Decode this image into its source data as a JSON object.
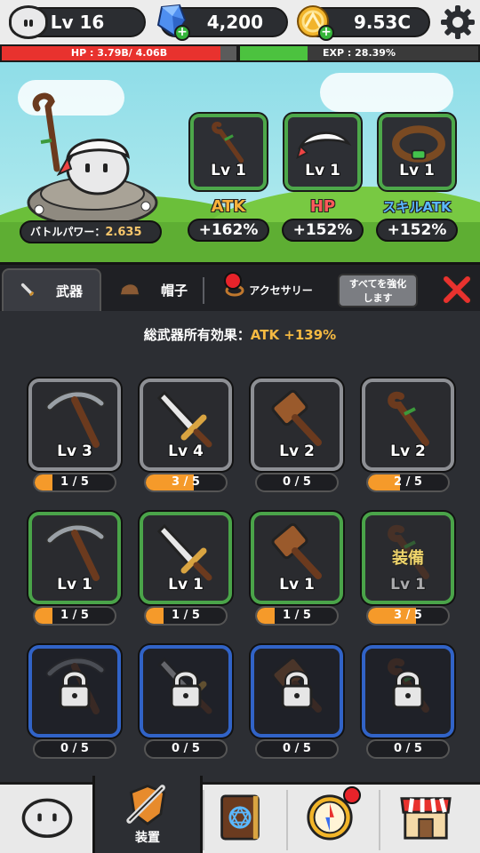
{
  "topbar": {
    "level": "Lv 16",
    "gems": "4,200",
    "coins": "9.53C"
  },
  "status": {
    "hp_text": "HP : 3.79B/ 4.06B",
    "hp_fraction": 0.933,
    "exp_text": "EXP : 28.39%",
    "exp_fraction": 0.2839
  },
  "character": {
    "power_label": "バトルパワー：",
    "power_value": "2.635"
  },
  "equipped": [
    {
      "slot": "weapon",
      "icon": "staff-icon",
      "level": "Lv 1",
      "stat_label": "ATK",
      "stat_color": "#f7b23b",
      "bonus": "+162%"
    },
    {
      "slot": "hat",
      "icon": "headband-icon",
      "level": "Lv 1",
      "stat_label": "HP",
      "stat_color": "#ff5a5a",
      "bonus": "+152%"
    },
    {
      "slot": "accessory",
      "icon": "bracelet-icon",
      "level": "Lv 1",
      "stat_label": "スキルATK",
      "stat_color": "#5ab8ff",
      "bonus": "+152%"
    }
  ],
  "tabs": [
    {
      "label": "武器",
      "icon": "sword-icon",
      "active": true
    },
    {
      "label": "帽子",
      "icon": "hat-icon",
      "active": false
    },
    {
      "label": "アクセサリー",
      "icon": "ring-icon",
      "active": false,
      "notify": true
    }
  ],
  "enhance_all": "すべてを強化\nします",
  "summary": {
    "label": "総武器所有効果：",
    "value": "ATK +139%"
  },
  "equipped_marker": "装備",
  "weapons": [
    {
      "icon": "pickaxe-icon",
      "rarity": "gray",
      "level": "Lv 3",
      "progress": "1 / 5",
      "fraction": 0.2
    },
    {
      "icon": "dagger-icon",
      "rarity": "gray",
      "level": "Lv 4",
      "progress": "3 / 5",
      "fraction": 0.6
    },
    {
      "icon": "hammer-icon",
      "rarity": "gray",
      "level": "Lv 2",
      "progress": "0 / 5",
      "fraction": 0
    },
    {
      "icon": "staff-icon",
      "rarity": "gray",
      "level": "Lv 2",
      "progress": "2 / 5",
      "fraction": 0.4
    },
    {
      "icon": "pickaxe-icon",
      "rarity": "green",
      "level": "Lv 1",
      "progress": "1 / 5",
      "fraction": 0.2
    },
    {
      "icon": "dagger-icon",
      "rarity": "green",
      "level": "Lv 1",
      "progress": "1 / 5",
      "fraction": 0.2
    },
    {
      "icon": "hammer-icon",
      "rarity": "green",
      "level": "Lv 1",
      "progress": "1 / 5",
      "fraction": 0.2
    },
    {
      "icon": "staff-icon",
      "rarity": "green",
      "level": "Lv 1",
      "progress": "3 / 5",
      "fraction": 0.6,
      "equipped": true
    },
    {
      "icon": "pickaxe-icon",
      "rarity": "blue",
      "locked": true,
      "progress": "0 / 5",
      "fraction": 0
    },
    {
      "icon": "dagger-icon",
      "rarity": "blue",
      "locked": true,
      "progress": "0 / 5",
      "fraction": 0
    },
    {
      "icon": "hammer-icon",
      "rarity": "blue",
      "locked": true,
      "progress": "0 / 5",
      "fraction": 0
    },
    {
      "icon": "staff-icon",
      "rarity": "blue",
      "locked": true,
      "progress": "0 / 5",
      "fraction": 0
    }
  ],
  "nav": [
    {
      "icon": "character-icon",
      "label": ""
    },
    {
      "icon": "equipment-icon",
      "label": "装置",
      "active": true
    },
    {
      "icon": "spellbook-icon",
      "label": ""
    },
    {
      "icon": "compass-icon",
      "label": "",
      "notify": true
    },
    {
      "icon": "shop-icon",
      "label": ""
    }
  ]
}
